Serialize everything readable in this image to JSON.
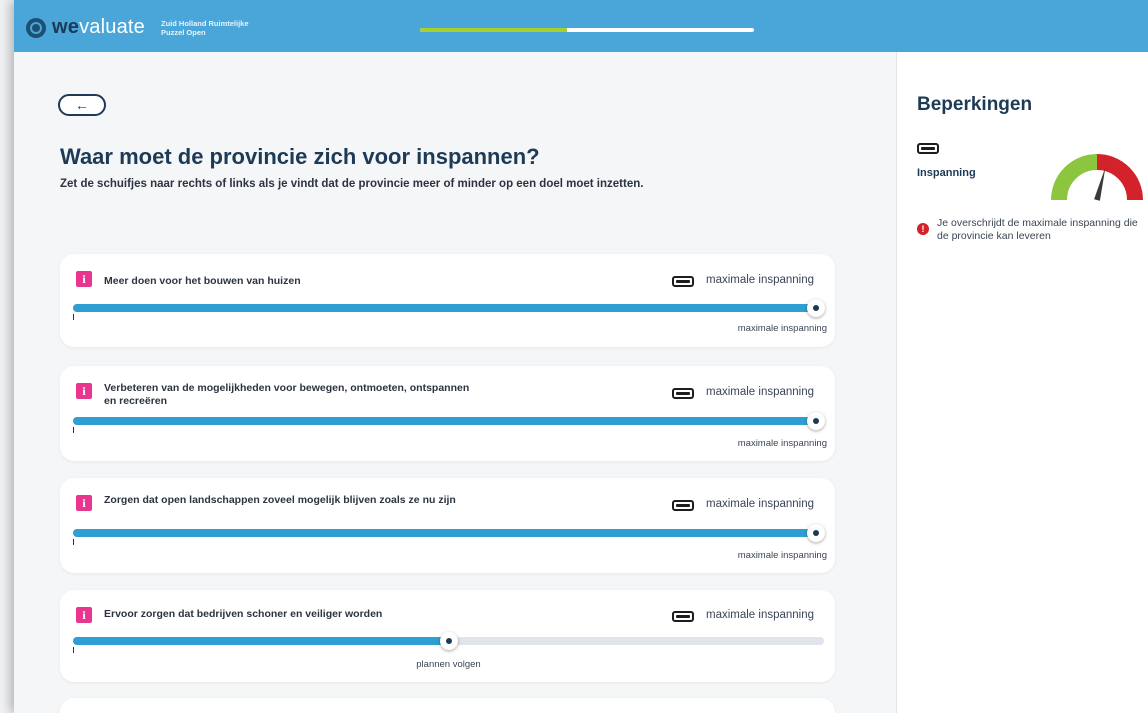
{
  "header": {
    "logo_we": "we",
    "logo_valuate": "valuate",
    "project_line1": "Zuid Holland Ruimtelijke",
    "project_line2": "Puzzel Open",
    "progress_fraction": 0.44,
    "progress_color": "#a7cf2e"
  },
  "main": {
    "back_icon": "←",
    "title": "Waar moet de provincie zich voor inspannen?",
    "subtitle": "Zet de schuifjes naar rechts of links als je vindt dat de provincie meer of minder op een doel moet inzetten.",
    "items": [
      {
        "label": "Meer doen voor het bouwen van huizen",
        "status": "maximale inspanning",
        "value_label": "maximale inspanning",
        "slider_value": 1.0
      },
      {
        "label": "Verbeteren van de mogelijkheden voor bewegen, ontmoeten, ontspannen en recreëren",
        "status": "maximale inspanning",
        "value_label": "maximale inspanning",
        "slider_value": 1.0
      },
      {
        "label": "Zorgen dat open landschappen zoveel mogelijk blijven zoals ze nu zijn",
        "status": "maximale inspanning",
        "value_label": "maximale inspanning",
        "slider_value": 1.0
      },
      {
        "label": "Ervoor zorgen dat bedrijven schoner en veiliger worden",
        "status": "maximale inspanning",
        "value_label": "plannen volgen",
        "slider_value": 0.5
      }
    ]
  },
  "side": {
    "title": "Beperkingen",
    "gauge_label": "Inspanning",
    "gauge_value": 0.58,
    "gauge_colors": {
      "green": "#8cc63f",
      "red": "#d3222a"
    },
    "warning_icon": "!",
    "warning_text": "Je overschrijdt de maximale inspanning die de provincie kan leveren"
  }
}
